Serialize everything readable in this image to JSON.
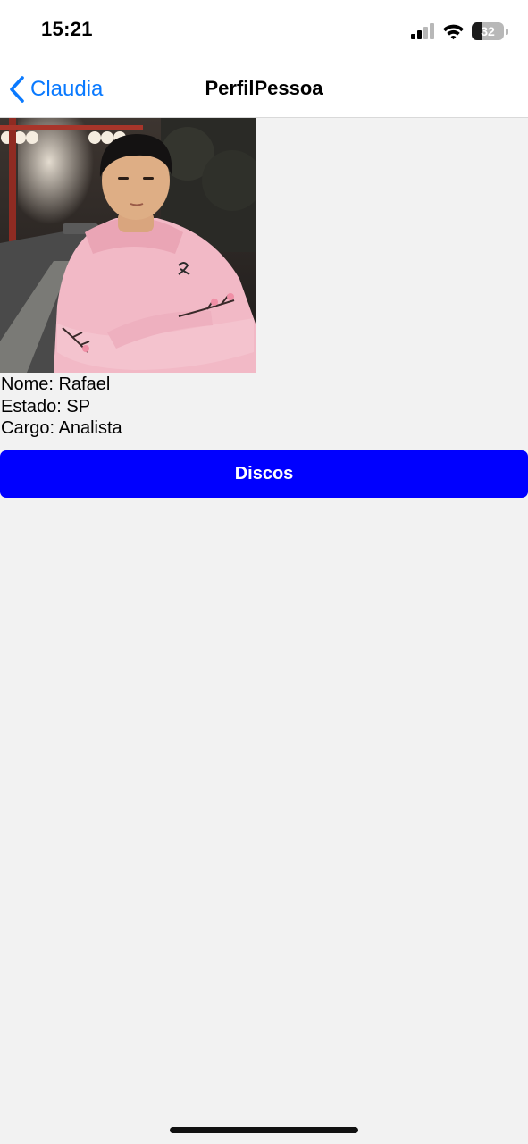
{
  "status_bar": {
    "time": "15:21",
    "battery_level": "32",
    "battery_fraction": 0.32,
    "icons": [
      "cellular-signal-icon",
      "wifi-icon",
      "battery-icon"
    ]
  },
  "nav": {
    "back_label": "Claudia",
    "title": "PerfilPessoa"
  },
  "profile": {
    "photo": "person-photo",
    "nome": "Nome: Rafael",
    "estado": "Estado: SP",
    "cargo": "Cargo: Analista"
  },
  "actions": {
    "discos_label": "Discos"
  },
  "colors": {
    "accent": "#0a7aff",
    "button": "#0000ff",
    "background": "#f2f2f2",
    "bar": "#ffffff"
  }
}
